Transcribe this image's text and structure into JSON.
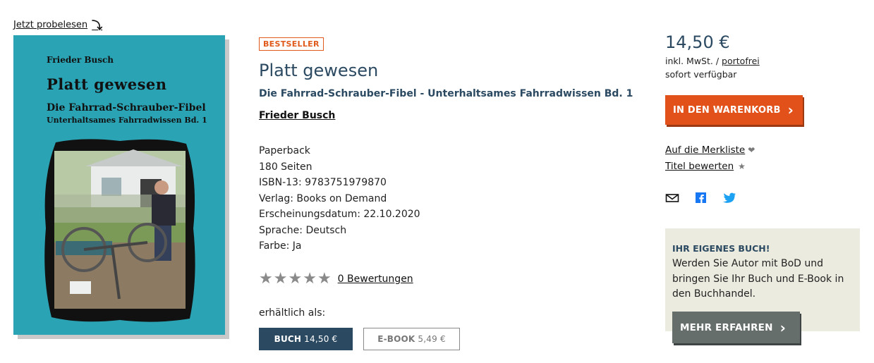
{
  "preview": {
    "label": "Jetzt probelesen"
  },
  "cover": {
    "author": "Frieder Busch",
    "title": "Platt gewesen",
    "subtitle1": "Die Fahrrad-Schrauber-Fibel",
    "subtitle2": "Unterhaltsames Fahrradwissen Bd. 1",
    "background": "#2aa3b4"
  },
  "product": {
    "badge": "BESTSELLER",
    "title": "Platt gewesen",
    "subtitle": "Die Fahrrad-Schrauber-Fibel - Unterhaltsames Fahrradwissen Bd. 1",
    "author": "Frieder Busch",
    "details": [
      "Paperback",
      "180 Seiten",
      "ISBN-13: 9783751979870",
      "Verlag: Books on Demand",
      "Erscheinungsdatum: 22.10.2020",
      "Sprache: Deutsch",
      "Farbe: Ja"
    ],
    "rating_stars": 5,
    "rating_link": "0 Bewertungen",
    "available_label": "erhältlich als:",
    "formats": {
      "book_type": "BUCH",
      "book_price": "14,50 €",
      "ebook_type": "E-BOOK",
      "ebook_price": "5,49 €"
    }
  },
  "purchase": {
    "price": "14,50 €",
    "tax_prefix": "inkl. MwSt. /",
    "shipping": "portofrei",
    "stock": "sofort verfügbar",
    "cart_button": "IN DEN WARENKORB",
    "wishlist": "Auf die Merkliste",
    "rate_title": "Titel bewerten",
    "share_icons": [
      "mail-icon",
      "facebook-icon",
      "twitter-icon"
    ]
  },
  "promo": {
    "heading": "IHR EIGENES BUCH!",
    "text": "Werden Sie Autor mit BoD und bringen Sie Ihr Buch und E-Book in den Buchhandel.",
    "button": "MEHR ERFAHREN"
  },
  "colors": {
    "accent_orange": "#e2511a",
    "title_blue": "#2b4a62",
    "promo_bg": "#ecebe0",
    "twitter": "#1da1f2",
    "facebook": "#1877f2"
  }
}
